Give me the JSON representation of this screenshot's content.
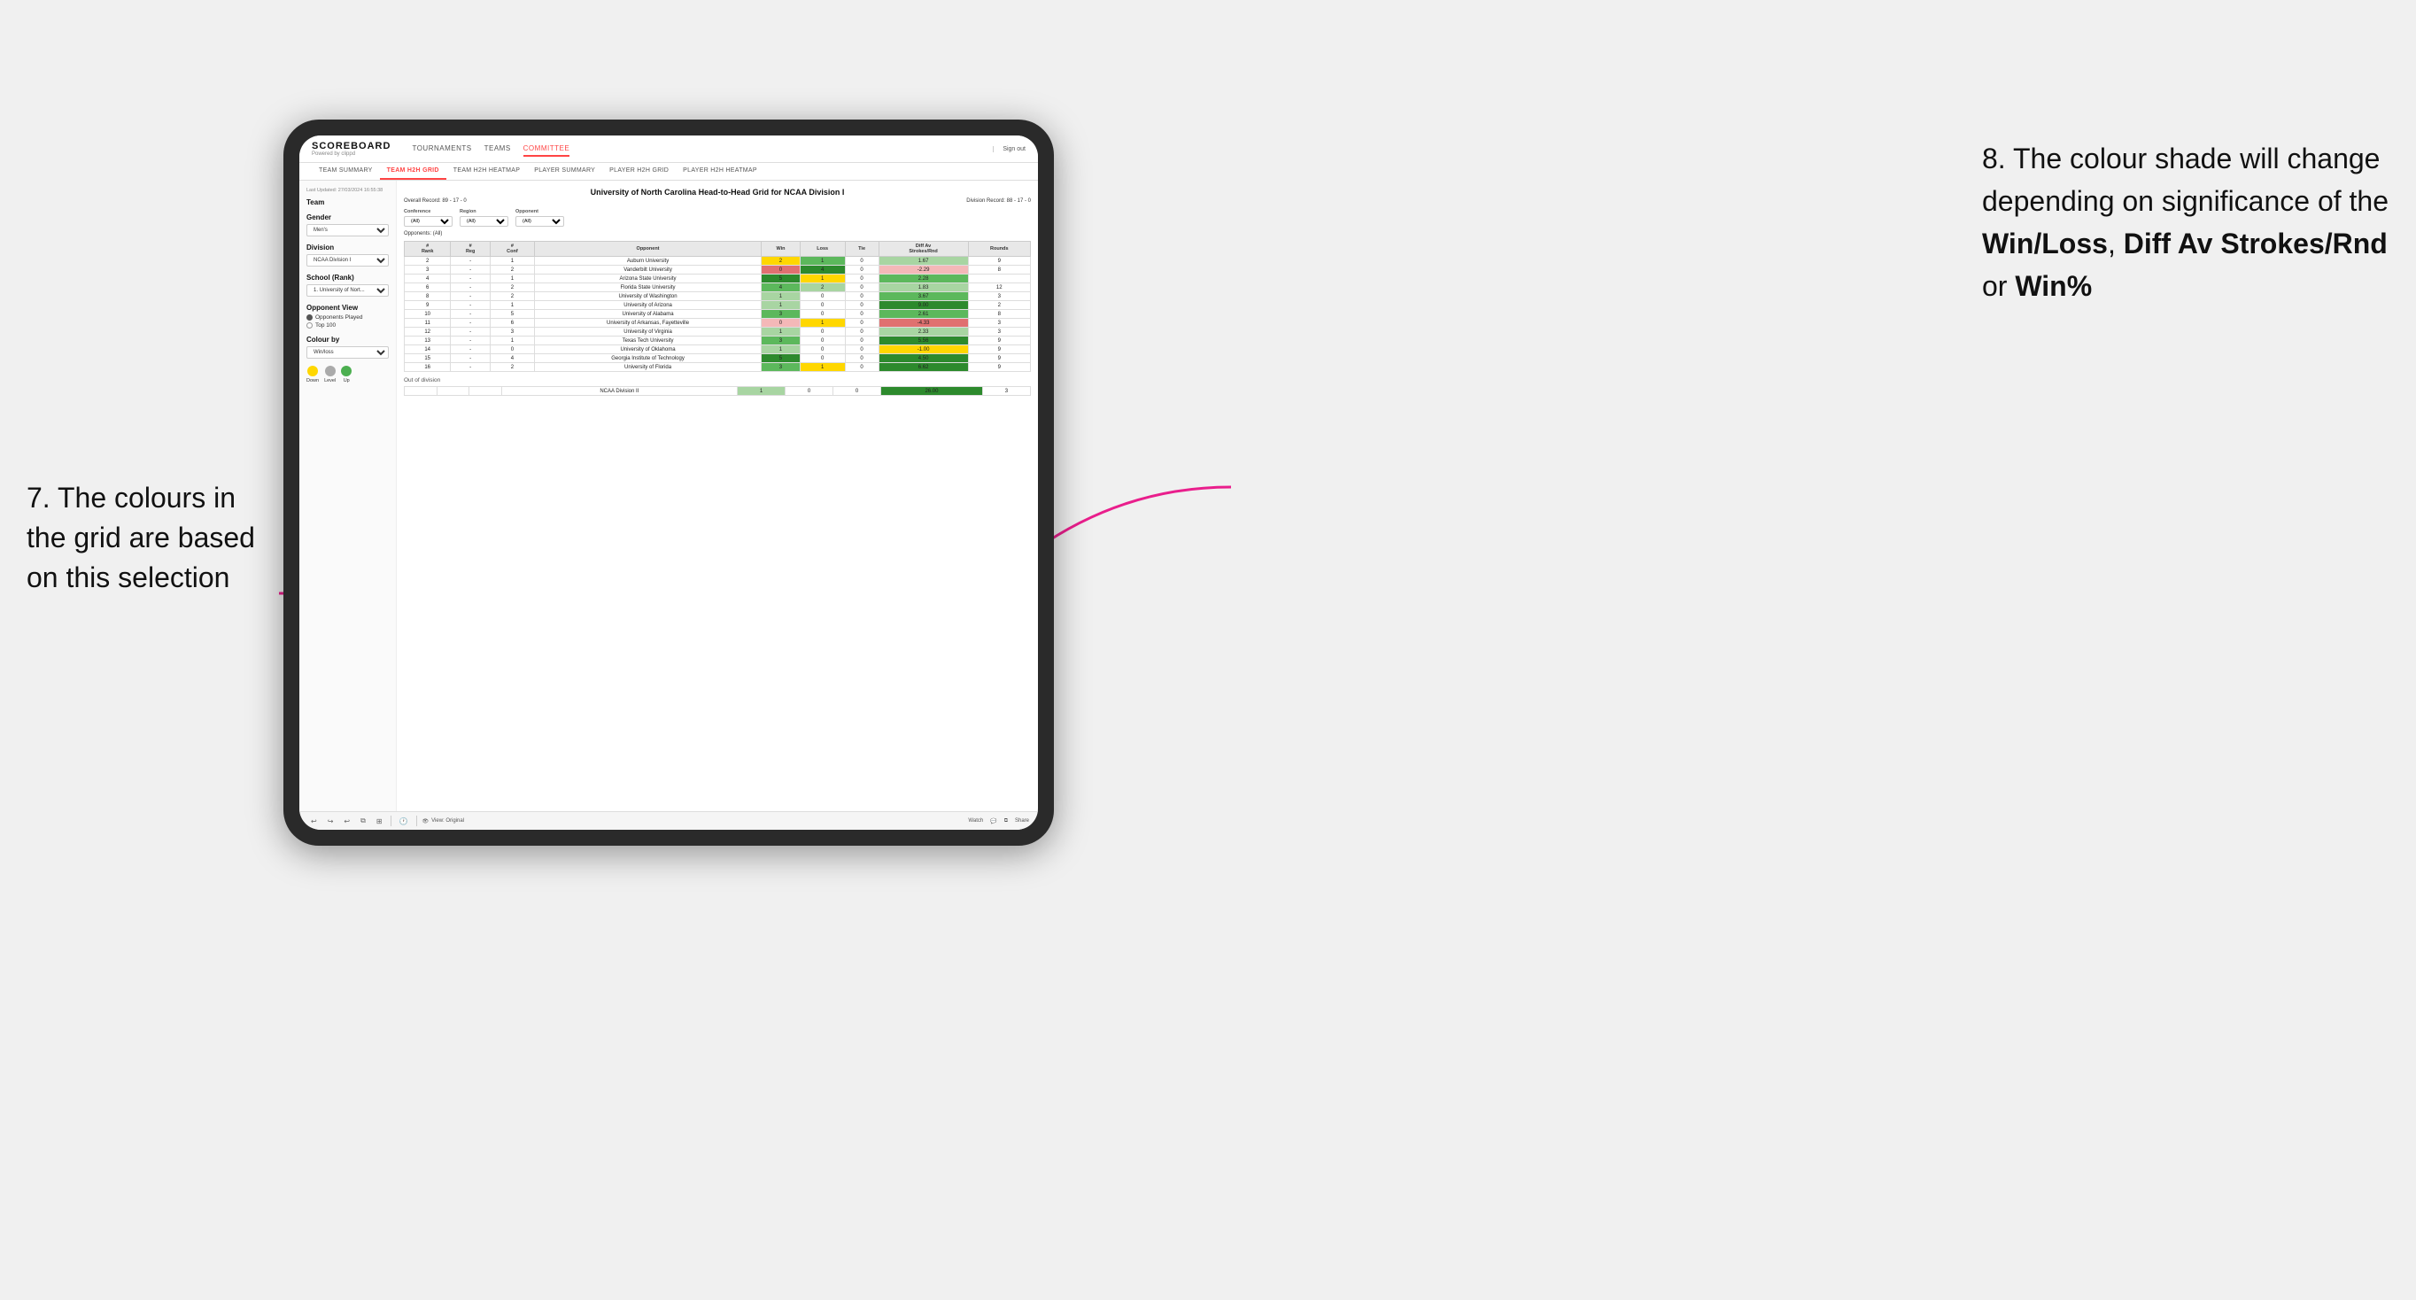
{
  "annotation_left": {
    "text": "7. The colours in the grid are based on this selection"
  },
  "annotation_right": {
    "line1": "8. The colour shade will change depending on significance of the ",
    "bold1": "Win/Loss",
    "line2": ", ",
    "bold2": "Diff Av Strokes/Rnd",
    "line3": " or ",
    "bold3": "Win%"
  },
  "nav": {
    "logo": "SCOREBOARD",
    "logo_sub": "Powered by clippd",
    "links": [
      "TOURNAMENTS",
      "TEAMS",
      "COMMITTEE"
    ],
    "sign_out": "Sign out"
  },
  "sub_nav": {
    "items": [
      "TEAM SUMMARY",
      "TEAM H2H GRID",
      "TEAM H2H HEATMAP",
      "PLAYER SUMMARY",
      "PLAYER H2H GRID",
      "PLAYER H2H HEATMAP"
    ],
    "active": "TEAM H2H GRID"
  },
  "sidebar": {
    "timestamp": "Last Updated: 27/03/2024 16:55:38",
    "team_label": "Team",
    "gender_label": "Gender",
    "gender_value": "Men's",
    "division_label": "Division",
    "division_value": "NCAA Division I",
    "school_label": "School (Rank)",
    "school_value": "1. University of Nort...",
    "opponent_view_label": "Opponent View",
    "radio_options": [
      "Opponents Played",
      "Top 100"
    ],
    "radio_selected": 0,
    "colour_by_label": "Colour by",
    "colour_by_value": "Win/loss",
    "legend": {
      "down_label": "Down",
      "level_label": "Level",
      "up_label": "Up",
      "down_color": "#ffd700",
      "level_color": "#aaa",
      "up_color": "#4caf50"
    }
  },
  "grid": {
    "title": "University of North Carolina Head-to-Head Grid for NCAA Division I",
    "overall_record": "Overall Record: 89 - 17 - 0",
    "division_record": "Division Record: 88 - 17 - 0",
    "filters": {
      "conference_label": "Conference",
      "conference_value": "(All)",
      "region_label": "Region",
      "region_value": "(All)",
      "opponent_label": "Opponent",
      "opponent_value": "(All)"
    },
    "opponents_label": "Opponents: (All)",
    "columns": [
      "#\nRank",
      "#\nReg",
      "#\nConf",
      "Opponent",
      "Win",
      "Loss",
      "Tie",
      "Diff Av\nStrokes/Rnd",
      "Rounds"
    ],
    "rows": [
      {
        "rank": "2",
        "reg": "-",
        "conf": "1",
        "opponent": "Auburn University",
        "win": "2",
        "loss": "1",
        "tie": "0",
        "diff": "1.67",
        "rounds": "9",
        "win_class": "cell-yellow",
        "loss_class": "cell-green-med",
        "diff_class": "cell-green-light"
      },
      {
        "rank": "3",
        "reg": "-",
        "conf": "2",
        "opponent": "Vanderbilt University",
        "win": "0",
        "loss": "4",
        "tie": "0",
        "diff": "-2.29",
        "rounds": "8",
        "win_class": "cell-red-med",
        "loss_class": "cell-green-dark",
        "diff_class": "cell-red-light"
      },
      {
        "rank": "4",
        "reg": "-",
        "conf": "1",
        "opponent": "Arizona State University",
        "win": "5",
        "loss": "1",
        "tie": "0",
        "diff": "2.28",
        "rounds": "",
        "win_class": "cell-green-dark",
        "loss_class": "cell-yellow",
        "diff_class": "cell-green-med"
      },
      {
        "rank": "6",
        "reg": "-",
        "conf": "2",
        "opponent": "Florida State University",
        "win": "4",
        "loss": "2",
        "tie": "0",
        "diff": "1.83",
        "rounds": "12",
        "win_class": "cell-green-med",
        "loss_class": "cell-green-light",
        "diff_class": "cell-green-light"
      },
      {
        "rank": "8",
        "reg": "-",
        "conf": "2",
        "opponent": "University of Washington",
        "win": "1",
        "loss": "0",
        "tie": "0",
        "diff": "3.67",
        "rounds": "3",
        "win_class": "cell-green-light",
        "loss_class": "cell-white",
        "diff_class": "cell-green-med"
      },
      {
        "rank": "9",
        "reg": "-",
        "conf": "1",
        "opponent": "University of Arizona",
        "win": "1",
        "loss": "0",
        "tie": "0",
        "diff": "9.00",
        "rounds": "2",
        "win_class": "cell-green-light",
        "loss_class": "cell-white",
        "diff_class": "cell-green-dark"
      },
      {
        "rank": "10",
        "reg": "-",
        "conf": "5",
        "opponent": "University of Alabama",
        "win": "3",
        "loss": "0",
        "tie": "0",
        "diff": "2.61",
        "rounds": "8",
        "win_class": "cell-green-med",
        "loss_class": "cell-white",
        "diff_class": "cell-green-med"
      },
      {
        "rank": "11",
        "reg": "-",
        "conf": "6",
        "opponent": "University of Arkansas, Fayetteville",
        "win": "0",
        "loss": "1",
        "tie": "0",
        "diff": "-4.33",
        "rounds": "3",
        "win_class": "cell-red-light",
        "loss_class": "cell-yellow",
        "diff_class": "cell-red-med"
      },
      {
        "rank": "12",
        "reg": "-",
        "conf": "3",
        "opponent": "University of Virginia",
        "win": "1",
        "loss": "0",
        "tie": "0",
        "diff": "2.33",
        "rounds": "3",
        "win_class": "cell-green-light",
        "loss_class": "cell-white",
        "diff_class": "cell-green-light"
      },
      {
        "rank": "13",
        "reg": "-",
        "conf": "1",
        "opponent": "Texas Tech University",
        "win": "3",
        "loss": "0",
        "tie": "0",
        "diff": "5.56",
        "rounds": "9",
        "win_class": "cell-green-med",
        "loss_class": "cell-white",
        "diff_class": "cell-green-dark"
      },
      {
        "rank": "14",
        "reg": "-",
        "conf": "0",
        "opponent": "University of Oklahoma",
        "win": "1",
        "loss": "0",
        "tie": "0",
        "diff": "-1.00",
        "rounds": "9",
        "win_class": "cell-green-light",
        "loss_class": "cell-white",
        "diff_class": "cell-yellow"
      },
      {
        "rank": "15",
        "reg": "-",
        "conf": "4",
        "opponent": "Georgia Institute of Technology",
        "win": "5",
        "loss": "0",
        "tie": "0",
        "diff": "4.50",
        "rounds": "9",
        "win_class": "cell-green-dark",
        "loss_class": "cell-white",
        "diff_class": "cell-green-dark"
      },
      {
        "rank": "16",
        "reg": "-",
        "conf": "2",
        "opponent": "University of Florida",
        "win": "3",
        "loss": "1",
        "tie": "0",
        "diff": "6.62",
        "rounds": "9",
        "win_class": "cell-green-med",
        "loss_class": "cell-yellow",
        "diff_class": "cell-green-dark"
      }
    ],
    "out_of_division_label": "Out of division",
    "out_of_division_row": {
      "name": "NCAA Division II",
      "win": "1",
      "loss": "0",
      "tie": "0",
      "diff": "26.00",
      "rounds": "3",
      "win_class": "cell-green-light",
      "diff_class": "cell-green-dark"
    }
  },
  "toolbar": {
    "view_label": "View: Original",
    "watch_label": "Watch",
    "share_label": "Share"
  }
}
